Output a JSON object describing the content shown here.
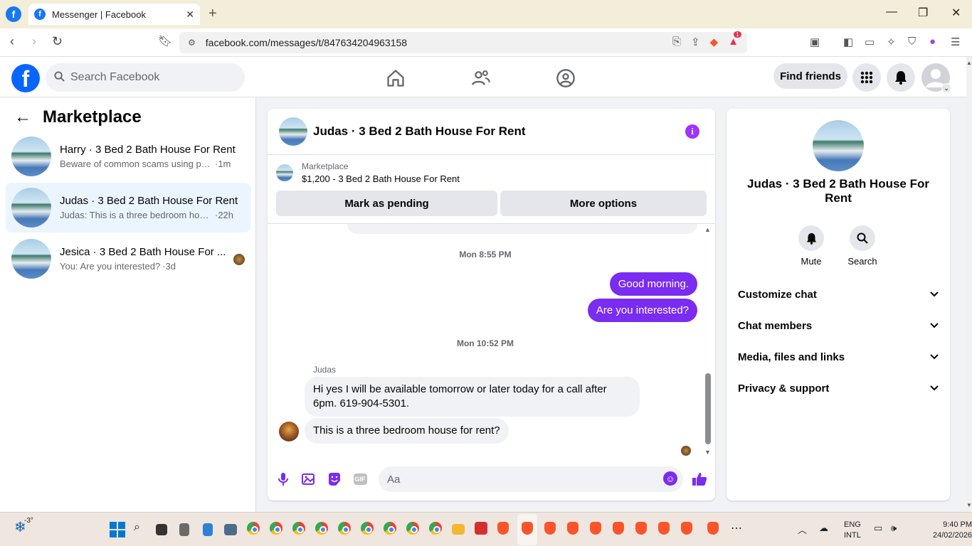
{
  "browser": {
    "tab_title": "Messenger | Facebook",
    "tab_favicon": "f",
    "url": "facebook.com/messages/t/847634204963158",
    "brave_badge": "1"
  },
  "header": {
    "search_placeholder": "Search Facebook",
    "find_friends": "Find friends"
  },
  "left": {
    "title": "Marketplace",
    "conversations": [
      {
        "name": "Harry · 3 Bed 2 Bath House For Rent",
        "snippet": "Beware of common scams using pay...",
        "time": "·1m"
      },
      {
        "name": "Judas · 3 Bed 2 Bath House For Rent",
        "snippet": "Judas: This is a three bedroom hous...",
        "time": "·22h"
      },
      {
        "name": "Jesica · 3 Bed 2 Bath House For ...",
        "snippet": "You: Are you interested?",
        "time": "·3d"
      }
    ]
  },
  "chat": {
    "title": "Judas · 3 Bed 2 Bath House For Rent",
    "marketplace_label": "Marketplace",
    "listing": "$1,200 - 3 Bed 2 Bath House For Rent",
    "mark_pending": "Mark as pending",
    "more_options": "More options",
    "ts1": "Mon 8:55 PM",
    "out1": "Good morning.",
    "out2": "Are you interested?",
    "ts2": "Mon 10:52 PM",
    "sender": "Judas",
    "in1": "Hi yes I will be available tomorrow or later today for a call after 6pm. 619-904-5301.",
    "in2": "This is a three bedroom house for rent?",
    "composer_placeholder": "Aa"
  },
  "right": {
    "name": "Judas · 3 Bed 2 Bath House For Rent",
    "mute": "Mute",
    "search": "Search",
    "sections": [
      "Customize chat",
      "Chat members",
      "Media, files and links",
      "Privacy & support"
    ]
  },
  "taskbar": {
    "temperature": "-3°",
    "lang1": "ENG",
    "lang2": "INTL",
    "time": "9:40 PM",
    "date": "24/02/2026"
  },
  "colors": {
    "facebook_blue": "#0866ff",
    "messenger_purple": "#7a2cf0",
    "active_conv_bg": "#ebf5ff"
  }
}
